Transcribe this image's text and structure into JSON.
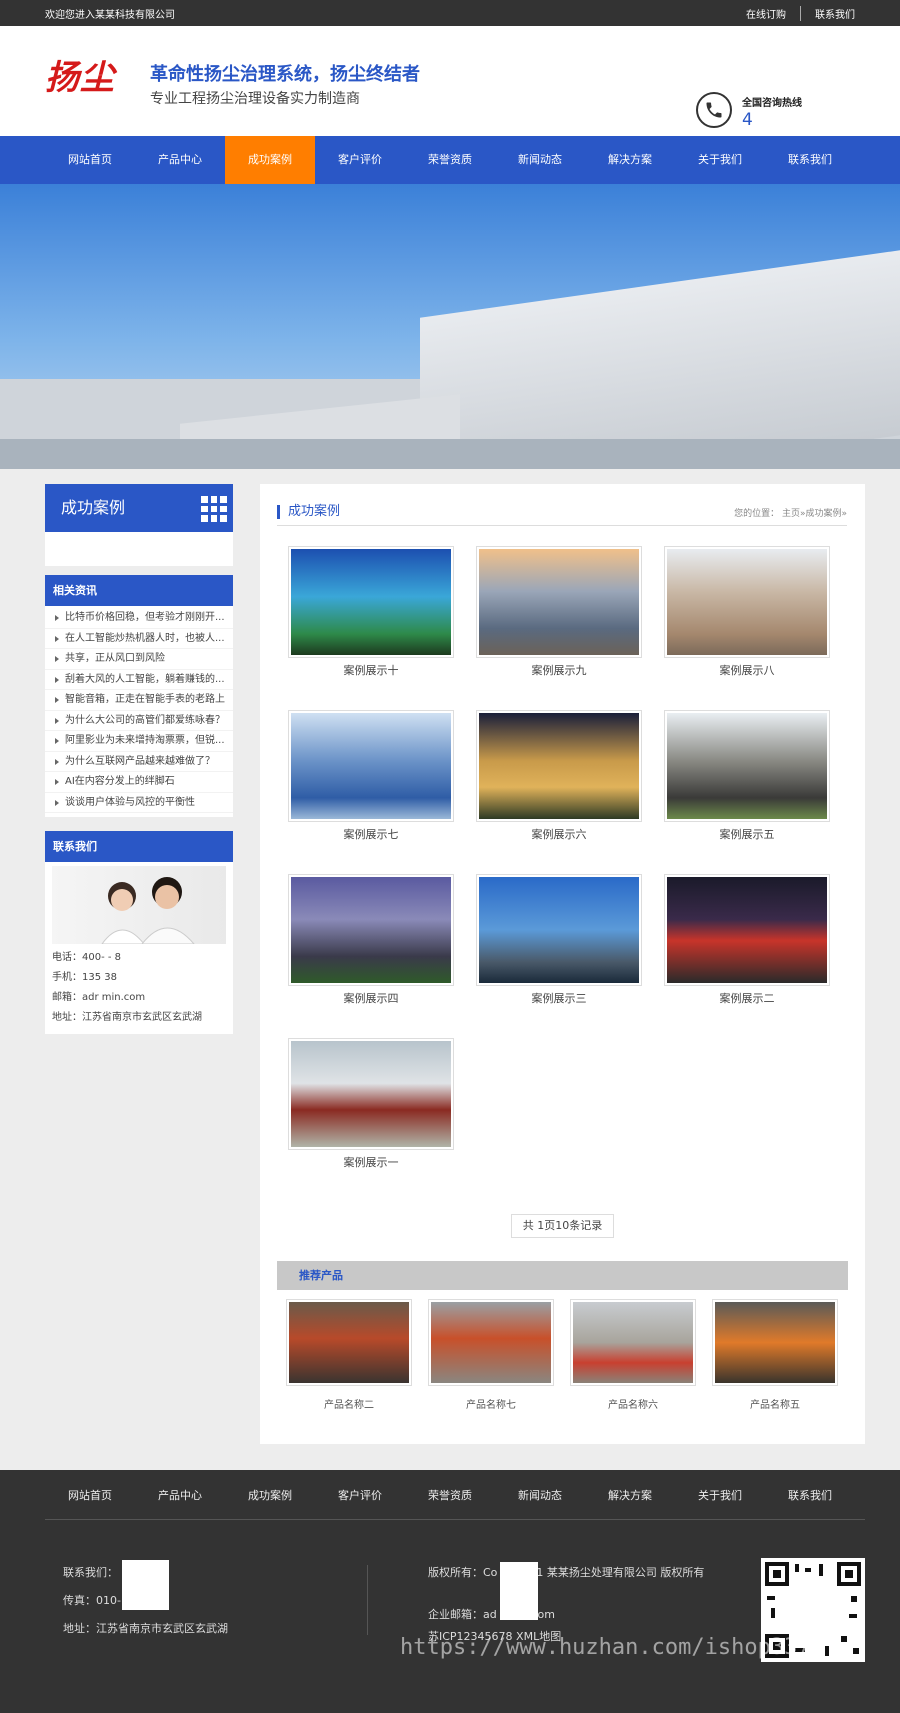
{
  "topbar": {
    "welcome": "欢迎您进入某某科技有限公司",
    "order": "在线订购",
    "contact": "联系我们"
  },
  "header": {
    "logo_text": "扬尘",
    "slogan_main": "革命性扬尘治理系统，扬尘终结者",
    "slogan_sub": "专业工程扬尘治理设备实力制造商",
    "hotline_label": "全国咨询热线",
    "hotline": "40          388"
  },
  "nav": [
    "网站首页",
    "产品中心",
    "成功案例",
    "客户评价",
    "荣誉资质",
    "新闻动态",
    "解决方案",
    "关于我们",
    "联系我们"
  ],
  "nav_active": "成功案例",
  "sidebar": {
    "title": "成功案例",
    "news_head": "相关资讯",
    "news": [
      "比特币价格回稳，但考验才刚刚开...",
      "在人工智能炒热机器人时，也被人...",
      "共享，正从风口到风险",
      "刮着大风的人工智能，躺着赚钱的...",
      "智能音箱，正走在智能手表的老路上",
      "为什么大公司的高管们都爱练咏春？",
      "阿里影业为未来增持淘票票，但锐...",
      "为什么互联网产品越来越难做了？",
      "AI在内容分发上的绊脚石",
      "谈谈用户体验与风控的平衡性"
    ],
    "contact_head": "联系我们",
    "contact": [
      "电话：400-   -  8",
      "手机：135          38",
      "邮箱：adr            min.com",
      "地址：江苏省南京市玄武区玄武湖"
    ]
  },
  "main": {
    "title": "成功案例",
    "breadcrumb": "您的位置：  主页»成功案例»",
    "cases": [
      "案例展示十",
      "案例展示九",
      "案例展示八",
      "案例展示七",
      "案例展示六",
      "案例展示五",
      "案例展示四",
      "案例展示三",
      "案例展示二",
      "案例展示一"
    ],
    "pager": "共 1页10条记录",
    "recommend_head": "推荐产品",
    "products": [
      "产品名称二",
      "产品名称七",
      "产品名称六",
      "产品名称五"
    ]
  },
  "footer": {
    "nav": [
      "网站首页",
      "产品中心",
      "成功案例",
      "客户评价",
      "荣誉资质",
      "新闻动态",
      "解决方案",
      "关于我们",
      "联系我们"
    ],
    "contact_phone": "联系我们：              888",
    "fax": "传真：010-             8",
    "address": "地址：江苏省南京市玄武区玄武湖",
    "copyright": "版权所有：Co         © 2021 某某扬尘处理有限公司 版权所有",
    "email": "企业邮箱：ad            dmin.com",
    "icp": "苏ICP12345678 XML地图"
  },
  "watermark": "https://www.huzhan.com/ishop3378",
  "colors": {
    "brand_blue": "#2a57c6",
    "nav_active": "#ff7e00",
    "footer_bg": "#333333"
  }
}
